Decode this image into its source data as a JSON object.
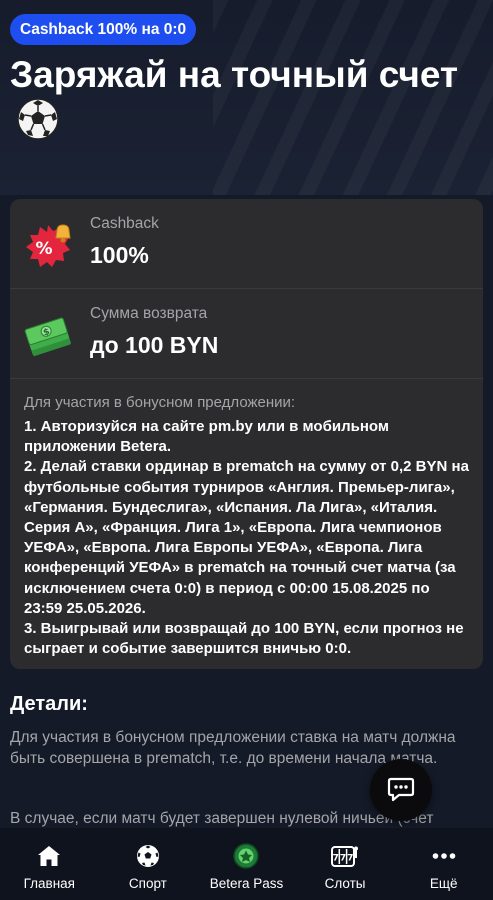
{
  "promo": {
    "badge": "Cashback 100% на 0:0",
    "title": "Заряжай на точный счет"
  },
  "card": {
    "rows": [
      {
        "icon": "percent-bell-icon",
        "label": "Cashback",
        "value": "100%"
      },
      {
        "icon": "money-stack-icon",
        "label": "Сумма возврата",
        "value": "до 100 BYN"
      }
    ],
    "terms_intro": "Для участия в бонусном предложении:",
    "terms": [
      "1. Авторизуйся на сайте pm.by или в мобильном приложении Betera.",
      "2. Делай ставки ординар в prematch на сумму от 0,2 BYN на футбольные события турниров «Англия. Премьер-лига», «Германия. Бундеслига», «Испания. Ла Лига», «Италия. Серия А», «Франция. Лига 1», «Европа. Лига чемпионов УЕФА», «Европа. Лига Европы УЕФА», «Европа. Лига конференций УЕФА» в prematch на точный счет матча (за исключением счета 0:0) в период с 00:00 15.08.2025 по 23:59 25.05.2026.",
      "3. Выигрывай или возвращай до 100 BYN, если прогноз не сыграет и событие завершится вничью 0:0."
    ]
  },
  "details": {
    "title": "Детали:",
    "paragraph_1": "Для участия в бонусном предложении ставка на матч должна быть совершена в prematch, т.е. до времени начала матча.",
    "paragraph_2": "В случае, если матч будет завершен нулевой ничьей (счет"
  },
  "nav": {
    "items": [
      {
        "label": "Главная",
        "icon": "home-icon"
      },
      {
        "label": "Спорт",
        "icon": "soccer-ball-icon"
      },
      {
        "label": "Betera Pass",
        "icon": "betera-pass-icon"
      },
      {
        "label": "Слоты",
        "icon": "slots-icon"
      },
      {
        "label": "Ещё",
        "icon": "more-dots-icon"
      }
    ]
  },
  "colors": {
    "background": "#141a28",
    "badge": "#1f4ef0",
    "card": "#2c2c2e",
    "muted_text": "#a5a5a9",
    "nav_background": "#0f131d"
  }
}
